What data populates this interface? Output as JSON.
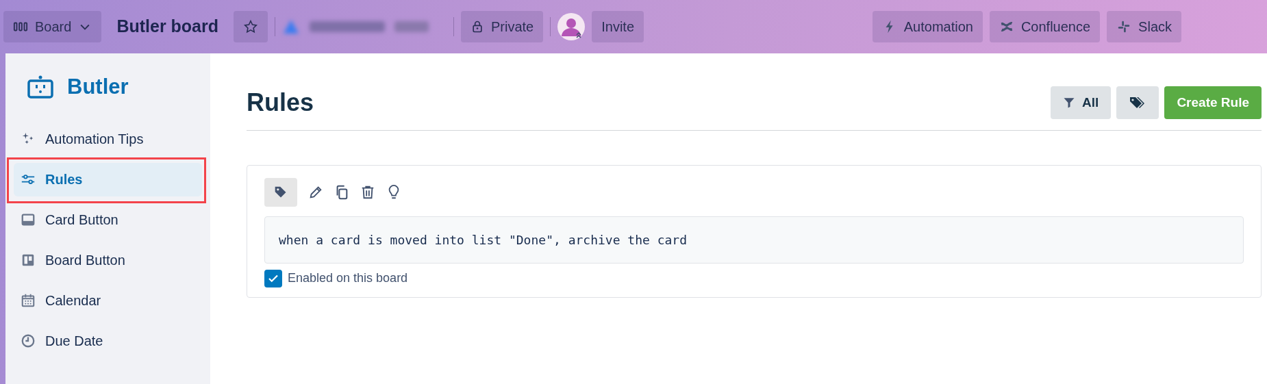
{
  "topbar": {
    "view_button": "Board",
    "board_title": "Butler board",
    "starred": false,
    "visibility": "Private",
    "invite": "Invite",
    "power_ups": [
      {
        "kind": "bolt",
        "label": "Automation"
      },
      {
        "kind": "confluence",
        "label": "Confluence"
      },
      {
        "kind": "slack",
        "label": "Slack"
      }
    ]
  },
  "sidebar": {
    "title": "Butler",
    "items": [
      {
        "kind": "sparkle",
        "label": "Automation Tips",
        "selected": false,
        "outlined": false
      },
      {
        "kind": "sliders",
        "label": "Rules",
        "selected": true,
        "outlined": true
      },
      {
        "kind": "card",
        "label": "Card Button",
        "selected": false,
        "outlined": false
      },
      {
        "kind": "board",
        "label": "Board Button",
        "selected": false,
        "outlined": false
      },
      {
        "kind": "calendar",
        "label": "Calendar",
        "selected": false,
        "outlined": false
      },
      {
        "kind": "clock",
        "label": "Due Date",
        "selected": false,
        "outlined": false
      }
    ]
  },
  "main": {
    "title": "Rules",
    "filter_button": "All",
    "create_button": "Create Rule",
    "rules": [
      {
        "text": "when a card is moved into list \"Done\", archive the card",
        "enabled": true,
        "enabled_label": "Enabled on this board"
      }
    ]
  }
}
